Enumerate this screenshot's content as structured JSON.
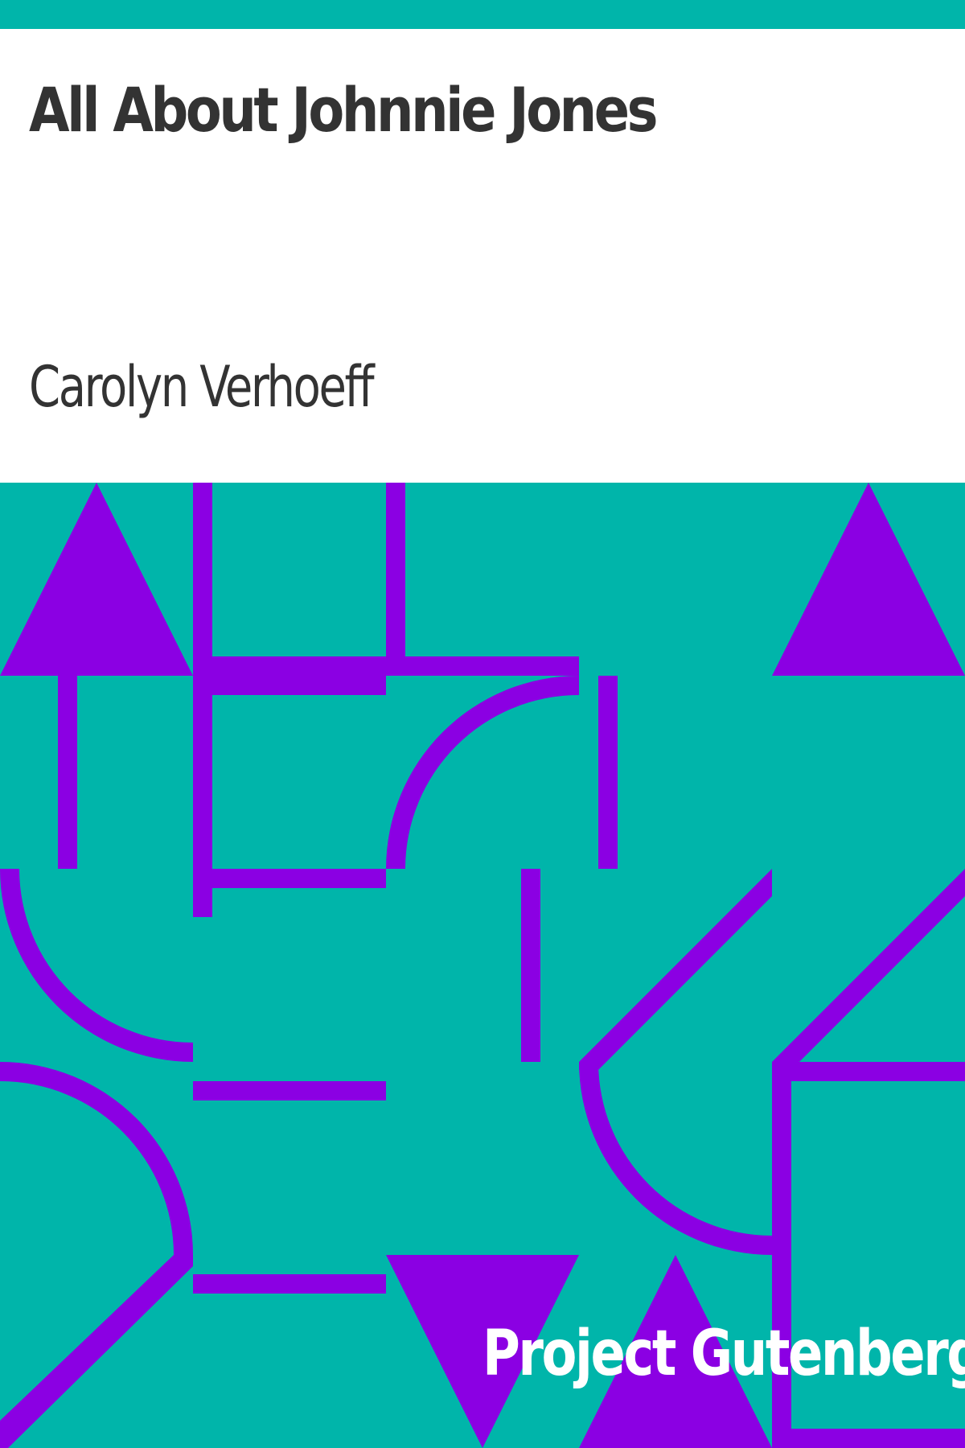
{
  "book": {
    "title": "All About Johnnie Jones",
    "author": "Carolyn Verhoeff",
    "publisher": "Project Gutenberg"
  },
  "colors": {
    "background": "#00b5aa",
    "shape": "#8b00e3",
    "title_panel": "#ffffff",
    "text": "#333333",
    "publisher_text": "#ffffff"
  },
  "cover_art": "geometric-pattern-icon"
}
